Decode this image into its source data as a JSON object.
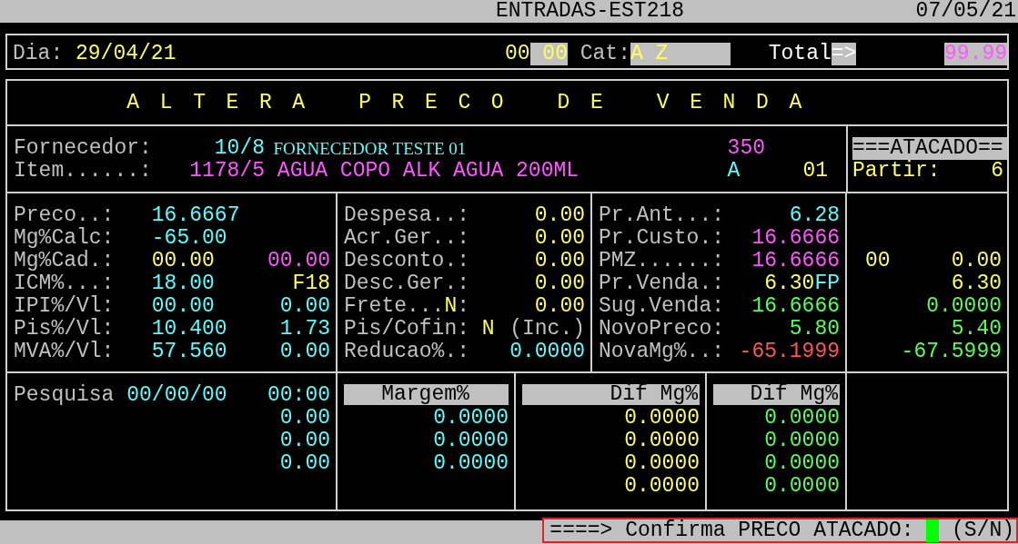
{
  "title_bar": {
    "title": "ENTRADAS-EST218",
    "date": "07/05/21"
  },
  "header": {
    "date_label": "Dia:",
    "date": "29/04/21",
    "field_1": "00",
    "field_2": "00",
    "cat_label": "Cat:",
    "cat": "A Z",
    "total_label": "Total",
    "total_arrow": "=>",
    "total": "99.99"
  },
  "form_title": "A L T E R A   P R E C O   D E   V E N D A",
  "product_rows": [
    {
      "label": "Fornecedor:",
      "code": {
        "text": "10/8",
        "color": "#55ffff"
      },
      "name": {
        "text": "FORNECEDOR TESTE 01",
        "color": "#55ffff",
        "kind": "serif"
      },
      "tag": {
        "text": "350",
        "color": "#ff55ff"
      }
    },
    {
      "label": "Item......:",
      "code": {
        "text": "1178/5",
        "color": "#ff55ff"
      },
      "name": {
        "text": "AGUA COPO ALK AGUA 200ML",
        "color": "#ff55ff",
        "kind": "mono"
      },
      "tag": {
        "text": "A",
        "color": "#55ffff"
      },
      "extra": {
        "text": "01",
        "color": "#ffff55"
      }
    }
  ],
  "wholesale": {
    "title": "===ATACADO==",
    "label": "Partir:",
    "value": "6"
  },
  "price_columns": [
    {
      "rows": [
        {
          "label": [
            {
              "text": "Preco..:"
            }
          ],
          "values": [
            {
              "text": "16.6667",
              "color": "#55ffff"
            }
          ]
        },
        {
          "label": [
            {
              "text": "Mg%Calc:"
            }
          ],
          "values": [
            {
              "text": "-65.00",
              "color": "#55ffff"
            }
          ]
        },
        {
          "label": [
            {
              "text": "Mg%Cad.:"
            }
          ],
          "values": [
            {
              "text": "00.00",
              "color": "#ffff55"
            },
            {
              "text": "00.00",
              "color": "#ff55ff"
            }
          ]
        },
        {
          "label": [
            {
              "text": "ICM%...:"
            }
          ],
          "values": [
            {
              "text": "18.00",
              "color": "#55ffff"
            },
            {
              "text": "F18",
              "color": "#ffff55"
            }
          ]
        },
        {
          "label": [
            {
              "text": "IPI%/Vl:"
            }
          ],
          "values": [
            {
              "text": "00.00",
              "color": "#55ffff"
            },
            {
              "text": "0.00",
              "color": "#55ffff"
            }
          ]
        },
        {
          "label": [
            {
              "text": "Pis%/Vl:"
            }
          ],
          "values": [
            {
              "text": "10.400",
              "color": "#55ffff"
            },
            {
              "text": "1.73",
              "color": "#55ffff"
            }
          ]
        },
        {
          "label": [
            {
              "text": "MVA%/Vl:"
            }
          ],
          "values": [
            {
              "text": "57.560",
              "color": "#55ffff"
            },
            {
              "text": "0.00",
              "color": "#55ffff"
            }
          ]
        }
      ]
    },
    {
      "rows": [
        {
          "label": [
            {
              "text": "Despesa..:"
            }
          ],
          "values": [
            {
              "text": "0.00",
              "color": "#ffff55"
            }
          ]
        },
        {
          "label": [
            {
              "text": "Acr.Ger..:"
            }
          ],
          "values": [
            {
              "text": "0.00",
              "color": "#ffff55"
            }
          ]
        },
        {
          "label": [
            {
              "text": "Desconto.:"
            }
          ],
          "values": [
            {
              "text": "0.00",
              "color": "#ffff55"
            }
          ]
        },
        {
          "label": [
            {
              "text": "Desc.Ger.:"
            }
          ],
          "values": [
            {
              "text": "0.00",
              "color": "#ffff55"
            }
          ]
        },
        {
          "label": [
            {
              "text": "Frete..."
            },
            {
              "text": "N",
              "color": "#ffff55"
            },
            {
              "text": ":"
            }
          ],
          "values": [
            {
              "text": "0.00",
              "color": "#ffff55"
            }
          ]
        },
        {
          "label": [
            {
              "text": "Pis/Cofin:"
            }
          ],
          "values": [
            {
              "text": "N",
              "color": "#ffff55"
            },
            {
              "text": "(Inc.)",
              "color": "#c0c0c0"
            }
          ]
        },
        {
          "label": [
            {
              "text": "Reducao%.:"
            }
          ],
          "values": [
            {
              "text": "0.0000",
              "color": "#55ffff"
            }
          ]
        }
      ]
    },
    {
      "rows": [
        {
          "label": [
            {
              "text": "Pr.Ant...:"
            }
          ],
          "values": [
            {
              "text": "6.28",
              "color": "#55ffff"
            }
          ]
        },
        {
          "label": [
            {
              "text": "Pr.Custo.:"
            }
          ],
          "values": [
            {
              "text": "16.6666",
              "color": "#ff55ff"
            }
          ]
        },
        {
          "label": [
            {
              "text": "PMZ......:"
            }
          ],
          "values": [
            {
              "text": "16.6666",
              "color": "#ff55ff"
            }
          ]
        },
        {
          "label": [
            {
              "text": "Pr.Venda.:"
            }
          ],
          "values": [
            {
              "text": "6.30",
              "color": "#ffff55"
            },
            {
              "text": "FP",
              "color": "#55ffff"
            }
          ]
        },
        {
          "label": [
            {
              "text": "Sug.Venda:"
            }
          ],
          "values": [
            {
              "text": "16.6666",
              "color": "#55ff55"
            }
          ]
        },
        {
          "label": [
            {
              "text": "NovoPreco:"
            }
          ],
          "values": [
            {
              "text": "5.80",
              "color": "#55ff55"
            }
          ]
        },
        {
          "label": [
            {
              "text": "NovaMg%..:"
            }
          ],
          "values": [
            {
              "text": "-65.1999",
              "color": "#ff5555"
            }
          ]
        }
      ]
    },
    {
      "rows": [
        {
          "values": [
            {
              "text": "00",
              "color": "#ffff55"
            },
            {
              "text": "0.00",
              "color": "#ffff55"
            }
          ]
        },
        {
          "values": [
            {
              "text": "6.30",
              "color": "#ffff55"
            }
          ]
        },
        {
          "values": [
            {
              "text": "0.0000",
              "color": "#55ff55"
            }
          ]
        },
        {
          "values": [
            {
              "text": "5.40",
              "color": "#55ff55"
            }
          ]
        },
        {
          "values": [
            {
              "text": "-67.5999",
              "color": "#55ff55"
            }
          ]
        }
      ]
    }
  ],
  "search": {
    "label": "Pesquisa",
    "date": "00/00/00",
    "time": "00:00",
    "values": [
      "0.00",
      "0.00",
      "0.00"
    ]
  },
  "margin_columns": [
    {
      "header": "Margem%",
      "color": "#55ffff",
      "values": [
        "0.0000",
        "0.0000",
        "0.0000"
      ]
    },
    {
      "header": "Dif Mg%",
      "color": "#ffff55",
      "values": [
        "0.0000",
        "0.0000",
        "0.0000",
        "0.0000"
      ]
    },
    {
      "header": "Dif Mg%",
      "color": "#55ff55",
      "values": [
        "0.0000",
        "0.0000",
        "0.0000",
        "0.0000"
      ]
    }
  ],
  "prompt": {
    "text": "====> Confirma PRECO ATACADO:",
    "options": "(S/N)"
  }
}
